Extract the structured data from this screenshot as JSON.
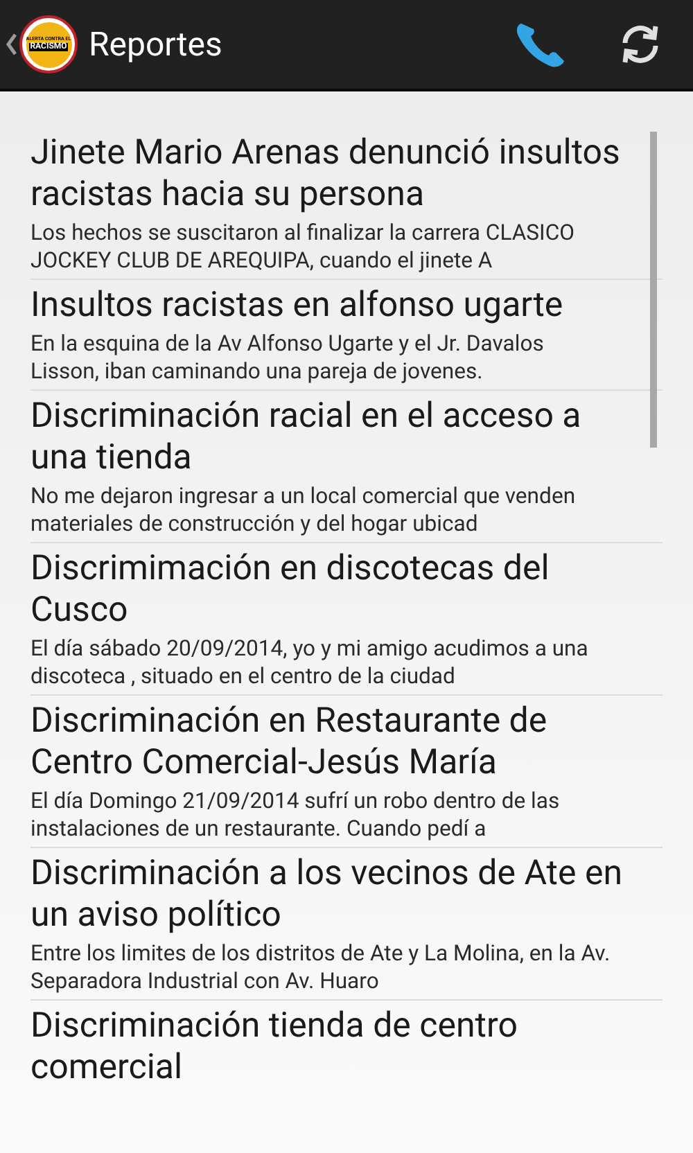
{
  "action_bar": {
    "title": "Reportes",
    "logo_lines": [
      "ALERTA CONTRA EL",
      "RACISMO"
    ]
  },
  "reports": [
    {
      "title": "Jinete Mario Arenas denunció insultos racistas hacia su persona",
      "summary": "Los hechos se suscitaron al finalizar la carrera CLASICO JOCKEY CLUB DE AREQUIPA, cuando el jinete A"
    },
    {
      "title": "Insultos racistas en alfonso ugarte",
      "summary": "En la esquina de la Av Alfonso Ugarte y el Jr. Davalos Lisson, iban caminando una pareja de jovenes."
    },
    {
      "title": "Discriminación racial en el acceso a una tienda",
      "summary": "No me dejaron ingresar a un local comercial que venden materiales de construcción y del hogar ubicad"
    },
    {
      "title": "Discrimimación en discotecas del Cusco",
      "summary": "El día sábado 20/09/2014, yo y mi amigo acudimos a una discoteca , situado en el centro de la ciudad"
    },
    {
      "title": "Discriminación en Restaurante de Centro Comercial-Jesús María",
      "summary": "El día Domingo 21/09/2014 sufrí un robo dentro de las instalaciones de un restaurante. Cuando pedí a"
    },
    {
      "title": "Discriminación a los vecinos de Ate en un aviso político",
      "summary": "Entre los limites de los distritos de Ate y La Molina, en la Av. Separadora Industrial con Av. Huaro"
    },
    {
      "title": "Discriminación tienda de centro comercial"
    }
  ]
}
